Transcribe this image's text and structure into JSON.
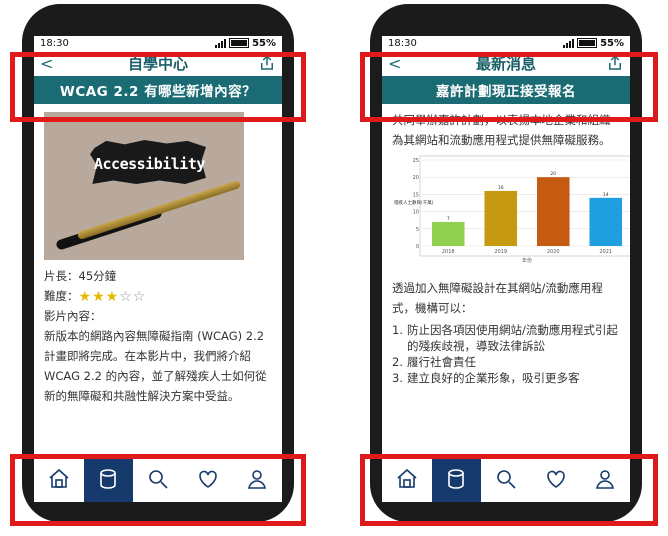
{
  "left_phone": {
    "status": {
      "time": "18:30",
      "battery": "55%"
    },
    "header": {
      "back_label": "<",
      "title": "自學中心"
    },
    "banner": "WCAG 2.2 有哪些新增內容？",
    "thumbnail_text": "Accessibility",
    "duration": "片長：45分鐘",
    "difficulty_label": "難度：",
    "rating": {
      "filled": 3,
      "total": 5
    },
    "content_label": "影片內容：",
    "description": "新版本的網路內容無障礙指南 (WCAG) 2.2 計畫即將完成。在本影片中，我們將介紹 WCAG 2.2 的內容，並了解殘疾人士如何從新的無障礙和共融性解決方案中受益。"
  },
  "right_phone": {
    "status": {
      "time": "18:30",
      "battery": "55%"
    },
    "header": {
      "back_label": "<",
      "title": "最新消息"
    },
    "banner": "嘉許計劃現正接受報名",
    "intro": "共同舉辦嘉許計劃，以表揚本地企業和組織為其網站和流動應用程式提供無障礙服務。",
    "lead": "透過加入無障礙設計在其網站/流動應用程式，機構可以：",
    "benefits": [
      {
        "num": "1.",
        "text": "防止因各項因使用網站/流動應用程式引起的殘疾歧視，導致法律訴訟"
      },
      {
        "num": "2.",
        "text": "履行社會責任"
      },
      {
        "num": "3.",
        "text": "建立良好的企業形象，吸引更多客"
      }
    ]
  },
  "chart_data": {
    "type": "bar",
    "categories": [
      "2018",
      "2019",
      "2020",
      "2021"
    ],
    "values": [
      7,
      16,
      20,
      14
    ],
    "colors": [
      "#92d050",
      "#c59a10",
      "#c55a11",
      "#1f9fe0"
    ],
    "ylim": [
      0,
      25
    ],
    "yticks": [
      0,
      5,
      10,
      15,
      20,
      25
    ],
    "ylabel": "殘疾人士數目(千萬)",
    "xlabel": "年份"
  },
  "nav_items": [
    {
      "name": "home",
      "icon": "home-icon",
      "active": false
    },
    {
      "name": "database",
      "icon": "database-icon",
      "active": true
    },
    {
      "name": "search",
      "icon": "search-icon",
      "active": false
    },
    {
      "name": "favorites",
      "icon": "heart-icon",
      "active": false
    },
    {
      "name": "profile",
      "icon": "user-icon",
      "active": false
    }
  ],
  "colors": {
    "accent": "#1a6b74",
    "nav_active": "#153a6b",
    "highlight": "#e01a1a"
  }
}
